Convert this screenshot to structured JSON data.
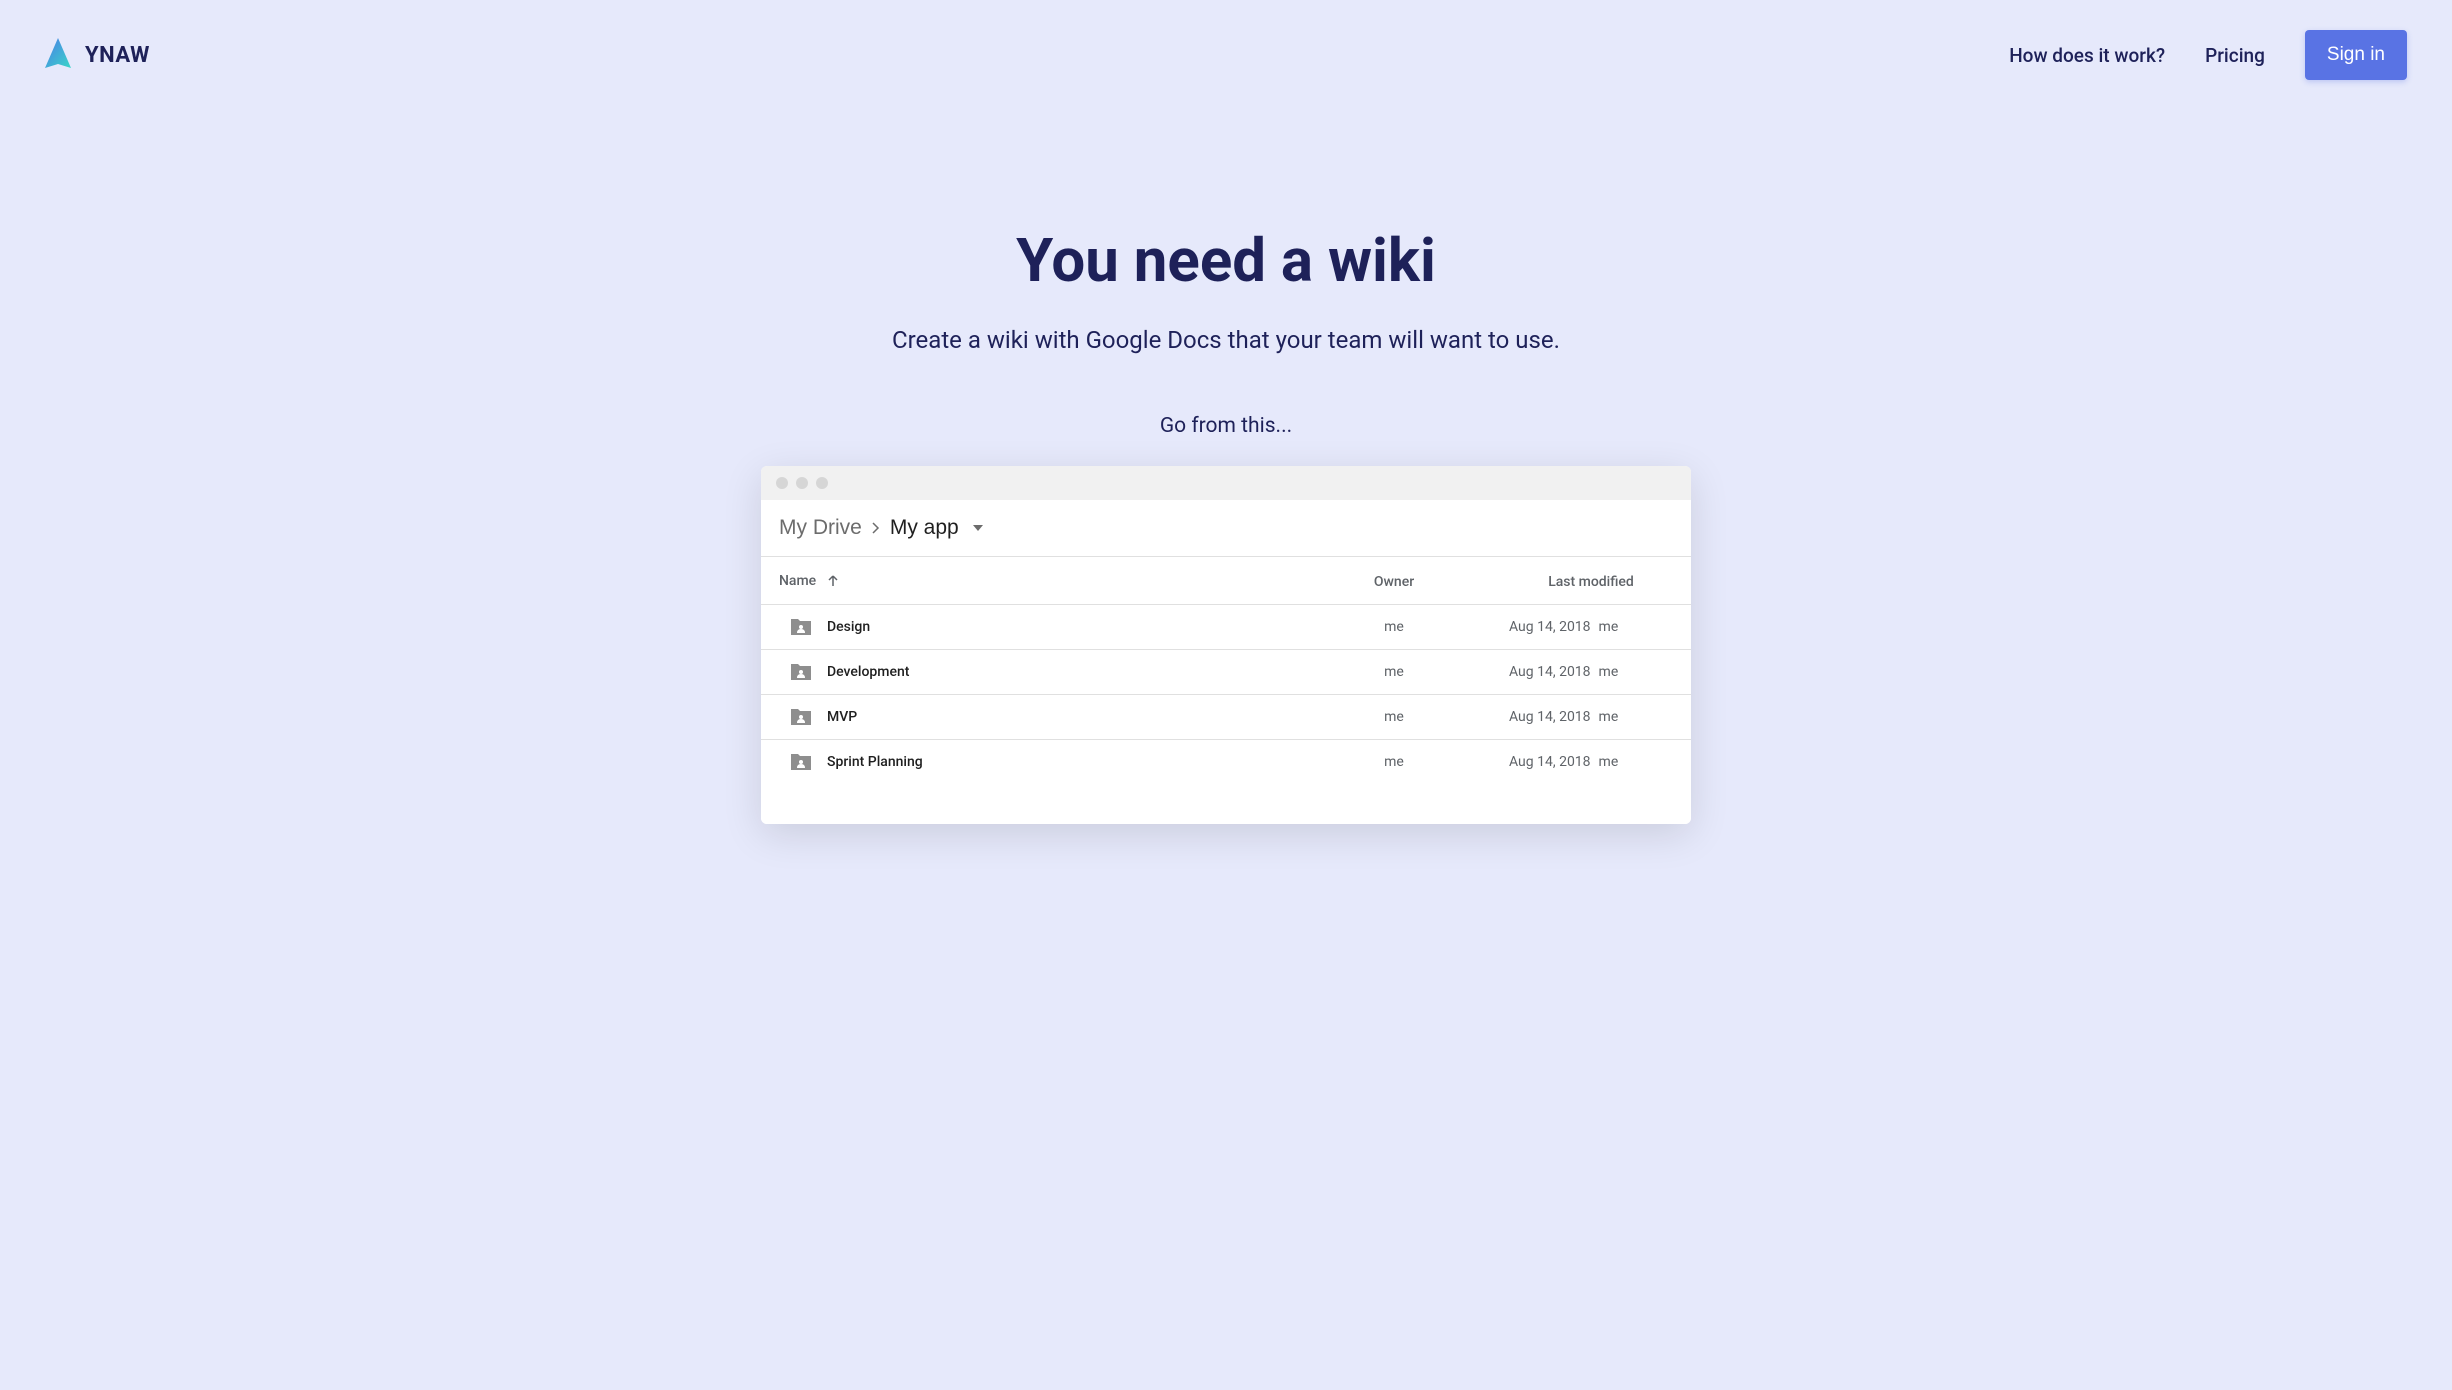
{
  "header": {
    "logo_text": "YNAW",
    "nav": {
      "how_it_works": "How does it work?",
      "pricing": "Pricing",
      "sign_in": "Sign in"
    }
  },
  "hero": {
    "title": "You need a wiki",
    "subtitle": "Create a wiki with Google Docs that your team will want to use.",
    "transition_label": "Go from this..."
  },
  "drive": {
    "breadcrumb": {
      "root": "My Drive",
      "current": "My app"
    },
    "columns": {
      "name": "Name",
      "owner": "Owner",
      "modified": "Last modified"
    },
    "rows": [
      {
        "name": "Design",
        "owner": "me",
        "date": "Aug 14, 2018",
        "modifier": "me"
      },
      {
        "name": "Development",
        "owner": "me",
        "date": "Aug 14, 2018",
        "modifier": "me"
      },
      {
        "name": "MVP",
        "owner": "me",
        "date": "Aug 14, 2018",
        "modifier": "me"
      },
      {
        "name": "Sprint Planning",
        "owner": "me",
        "date": "Aug 14, 2018",
        "modifier": "me"
      }
    ]
  }
}
